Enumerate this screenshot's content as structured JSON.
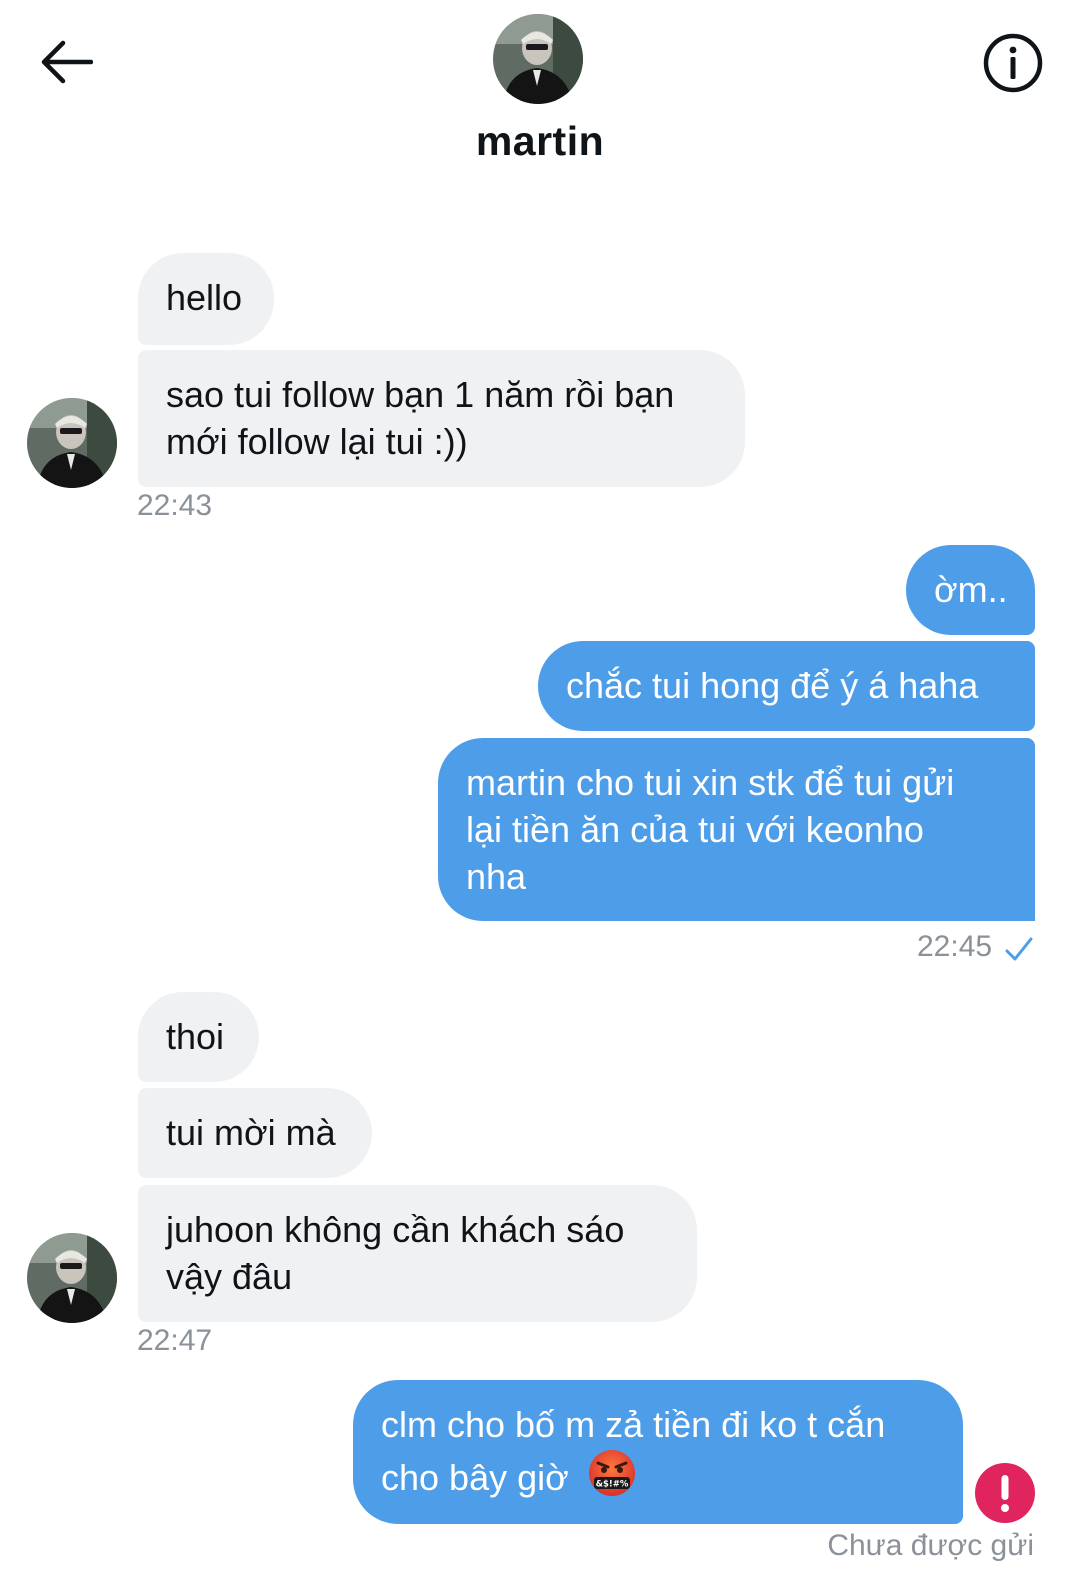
{
  "header": {
    "name": "martin",
    "back_icon": "arrow-left-icon",
    "info_icon": "info-circle-icon"
  },
  "colors": {
    "incoming_bubble": "#eff1f3",
    "outgoing_bubble": "#4d9de8",
    "timestamp": "#8a9198",
    "read_check": "#4d9de8",
    "error": "#e0245e"
  },
  "messages": {
    "g1": {
      "m1": "hello",
      "m2_line1": "sao tui follow bạn 1 năm rồi bạn",
      "m2_line2": "mới follow lại tui :))",
      "time": "22:43"
    },
    "g2": {
      "m1": "ờm..",
      "m2": "chắc tui hong để ý á haha",
      "m3_line1": "martin cho tui xin stk để tui gửi",
      "m3_line2": "lại tiền ăn của tui với keonho",
      "m3_line3": "nha",
      "time": "22:45",
      "status_icon": "check-icon"
    },
    "g3": {
      "m1": "thoi",
      "m2": "tui mời mà",
      "m3_line1": "juhoon không cần khách sáo",
      "m3_line2": "vậy đâu",
      "time": "22:47"
    },
    "g4": {
      "m1_line1": "clm cho bố m zả tiền đi ko t cắn",
      "m1_line2": "cho bây giờ",
      "emoji": "swearing-face-emoji",
      "status_text": "Chưa được gửi",
      "status_icon": "error-exclamation-icon"
    }
  }
}
